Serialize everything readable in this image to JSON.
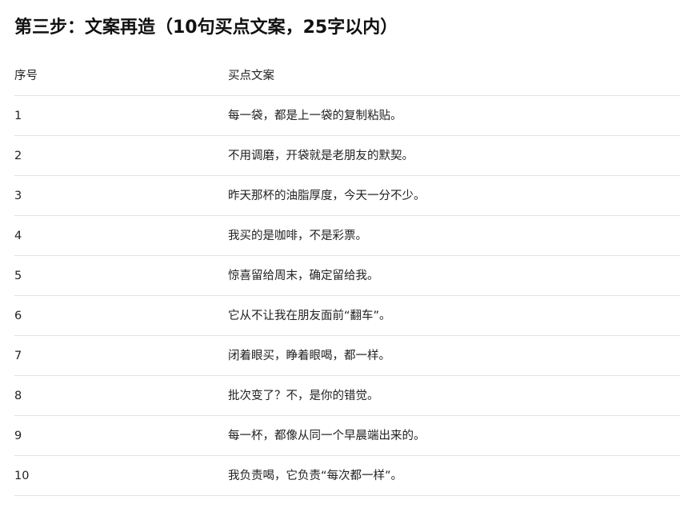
{
  "title": "第三步：文案再造（10句买点文案，25字以内）",
  "table": {
    "headers": [
      "序号",
      "买点文案"
    ],
    "rows": [
      {
        "index": "1",
        "text": "每一袋，都是上一袋的复制粘贴。"
      },
      {
        "index": "2",
        "text": "不用调磨，开袋就是老朋友的默契。"
      },
      {
        "index": "3",
        "text": "昨天那杯的油脂厚度，今天一分不少。"
      },
      {
        "index": "4",
        "text": "我买的是咖啡，不是彩票。"
      },
      {
        "index": "5",
        "text": "惊喜留给周末，确定留给我。"
      },
      {
        "index": "6",
        "text": "它从不让我在朋友面前“翻车”。"
      },
      {
        "index": "7",
        "text": "闭着眼买，睁着眼喝，都一样。"
      },
      {
        "index": "8",
        "text": "批次变了？不，是你的错觉。"
      },
      {
        "index": "9",
        "text": "每一杯，都像从同一个早晨端出来的。"
      },
      {
        "index": "10",
        "text": "我负责喝，它负责“每次都一样”。"
      }
    ]
  }
}
